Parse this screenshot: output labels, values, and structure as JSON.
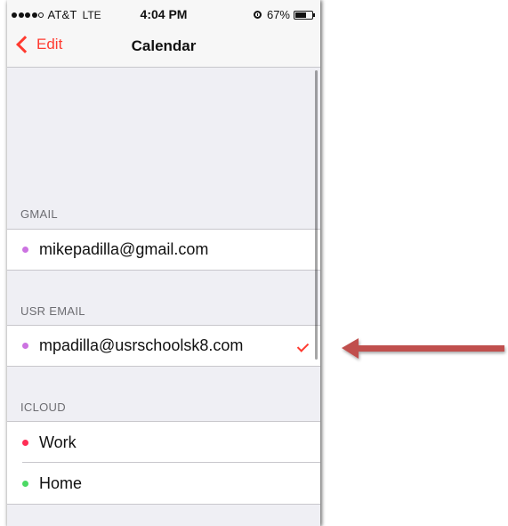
{
  "status_bar": {
    "carrier": "AT&T",
    "network": "LTE",
    "time": "4:04 PM",
    "battery_percent": "67%",
    "battery_level": 0.67,
    "signal_strength": 4,
    "signal_max": 5
  },
  "nav": {
    "back_label": "Edit",
    "title": "Calendar"
  },
  "sections": [
    {
      "header": "GMAIL",
      "items": [
        {
          "label": "mikepadilla@gmail.com",
          "color": "#cc73e1",
          "checked": false
        }
      ]
    },
    {
      "header": "USR EMAIL",
      "items": [
        {
          "label": "mpadilla@usrschoolsk8.com",
          "color": "#cc73e1",
          "checked": true
        }
      ]
    },
    {
      "header": "ICLOUD",
      "items": [
        {
          "label": "Work",
          "color": "#ff2d55",
          "checked": false
        },
        {
          "label": "Home",
          "color": "#4cd964",
          "checked": false
        }
      ]
    }
  ],
  "colors": {
    "accent": "#ff3b30",
    "arrow": "#c0504d"
  },
  "icons": {
    "back": "chevron-left-icon",
    "check": "checkmark-icon",
    "alarm": "alarm-clock-icon",
    "battery": "battery-icon",
    "annotation": "arrow-left-icon"
  }
}
